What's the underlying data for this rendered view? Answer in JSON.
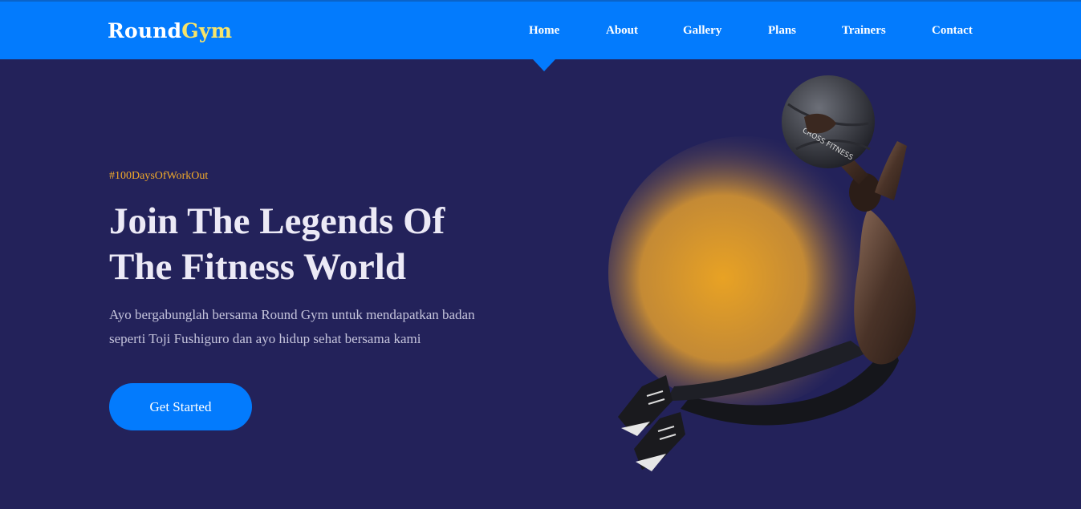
{
  "brand": {
    "name_part1": "Round",
    "name_part2": "Gym"
  },
  "nav": {
    "items": [
      {
        "label": "Home",
        "active": true
      },
      {
        "label": "About"
      },
      {
        "label": "Gallery"
      },
      {
        "label": "Plans"
      },
      {
        "label": "Trainers"
      },
      {
        "label": "Contact"
      }
    ]
  },
  "hero": {
    "tag": "#100DaysOfWorkOut",
    "title_line1": "Join The Legends Of",
    "title_line2": "The Fitness World",
    "description_line1": "Ayo bergabunglah bersama Round Gym untuk mendapatkan badan",
    "description_line2": "seperti Toji Fushiguro dan ayo hidup sehat bersama kami",
    "cta_label": "Get Started",
    "ball_text": "CROSS FITNESS"
  },
  "colors": {
    "navbar": "#037bfd",
    "background": "#23225a",
    "accent": "#f7e46a",
    "tag": "#f0a92a",
    "glow": "#e3a126"
  }
}
